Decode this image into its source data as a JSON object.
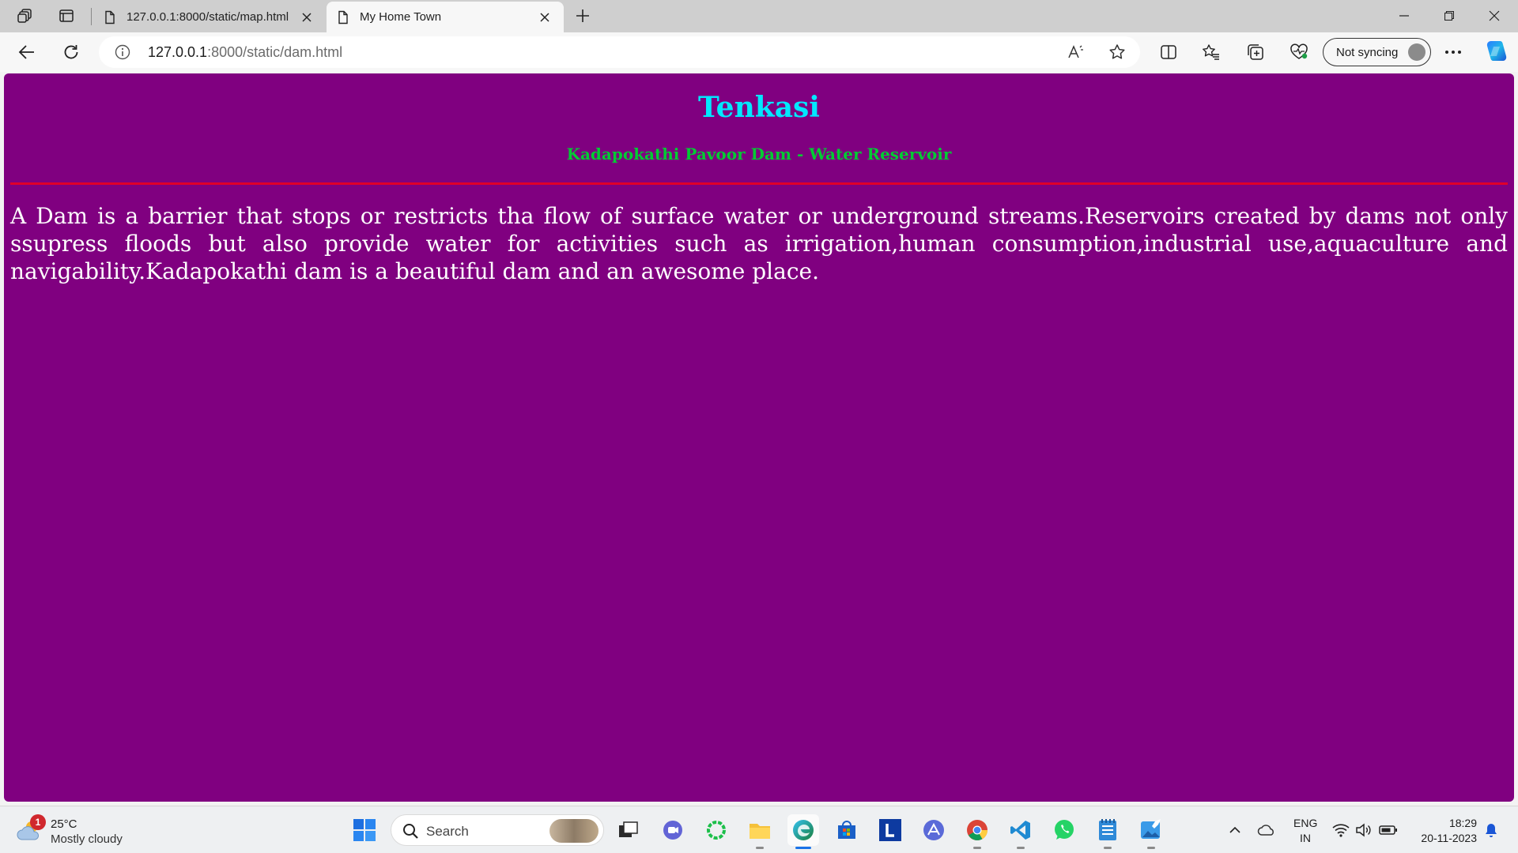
{
  "browser": {
    "tabs": [
      {
        "title": "127.0.0.1:8000/static/map.html",
        "active": false
      },
      {
        "title": "My Home Town",
        "active": true
      }
    ],
    "address": {
      "host": "127.0.0.1",
      "rest": ":8000/static/dam.html"
    },
    "sync_label": "Not syncing"
  },
  "page": {
    "background": "#800080",
    "title": "Tenkasi",
    "subtitle": "Kadapokathi Pavoor Dam - Water Reservoir",
    "paragraph": "A Dam is a barrier that stops or restricts tha flow of surface water or underground streams.Reservoirs created by dams not only ssupress floods but also provide water for activities such as irrigation,human consumption,industrial use,aquaculture and navigability.Kadapokathi dam is a beautiful dam and an awesome place.",
    "title_color": "#00e8ff",
    "subtitle_color": "#00cc33",
    "rule_color": "#e0002a"
  },
  "taskbar": {
    "weather_badge": "1",
    "weather_temp": "25°C",
    "weather_desc": "Mostly cloudy",
    "search_placeholder": "Search",
    "lang_line1": "ENG",
    "lang_line2": "IN",
    "time": "18:29",
    "date": "20-11-2023"
  }
}
